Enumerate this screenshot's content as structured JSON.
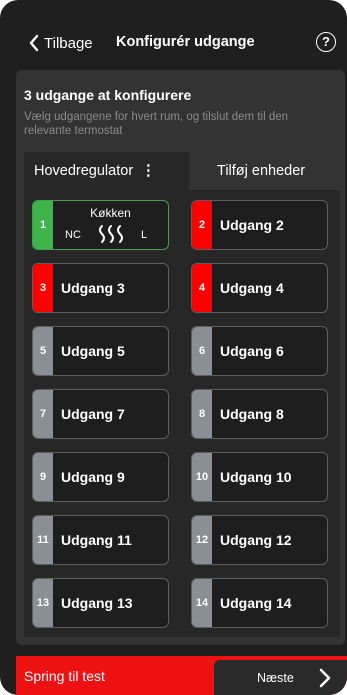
{
  "header": {
    "back_label": "Tilbage",
    "title": "Konfigurér udgange",
    "help_symbol": "?"
  },
  "panel": {
    "heading": "3 udgange at konfigurere",
    "subtitle": "Vælg udgangene for hvert rum, og tilslut dem til den relevante termostat"
  },
  "tabs": {
    "main": "Hovedregulator",
    "main_menu": "⋮",
    "add": "Tilføj enheder"
  },
  "configured_outlet": {
    "number": "1",
    "room": "Køkken",
    "nc": "NC",
    "l": "L",
    "color": "#3fb44a"
  },
  "outlets": [
    {
      "number": "2",
      "label": "Udgang 2",
      "color": "#ff0000"
    },
    {
      "number": "3",
      "label": "Udgang 3",
      "color": "#ff0000"
    },
    {
      "number": "4",
      "label": "Udgang 4",
      "color": "#ff0000"
    },
    {
      "number": "5",
      "label": "Udgang 5",
      "color": "#8a8e95"
    },
    {
      "number": "6",
      "label": "Udgang 6",
      "color": "#8a8e95"
    },
    {
      "number": "7",
      "label": "Udgang 7",
      "color": "#8a8e95"
    },
    {
      "number": "8",
      "label": "Udgang 8",
      "color": "#8a8e95"
    },
    {
      "number": "9",
      "label": "Udgang 9",
      "color": "#8a8e95"
    },
    {
      "number": "10",
      "label": "Udgang 10",
      "color": "#8a8e95"
    },
    {
      "number": "11",
      "label": "Udgang 11",
      "color": "#8a8e95"
    },
    {
      "number": "12",
      "label": "Udgang 12",
      "color": "#8a8e95"
    },
    {
      "number": "13",
      "label": "Udgang 13",
      "color": "#8a8e95"
    },
    {
      "number": "14",
      "label": "Udgang 14",
      "color": "#8a8e95"
    }
  ],
  "footer": {
    "skip_label": "Spring til test",
    "next_label": "Næste"
  }
}
